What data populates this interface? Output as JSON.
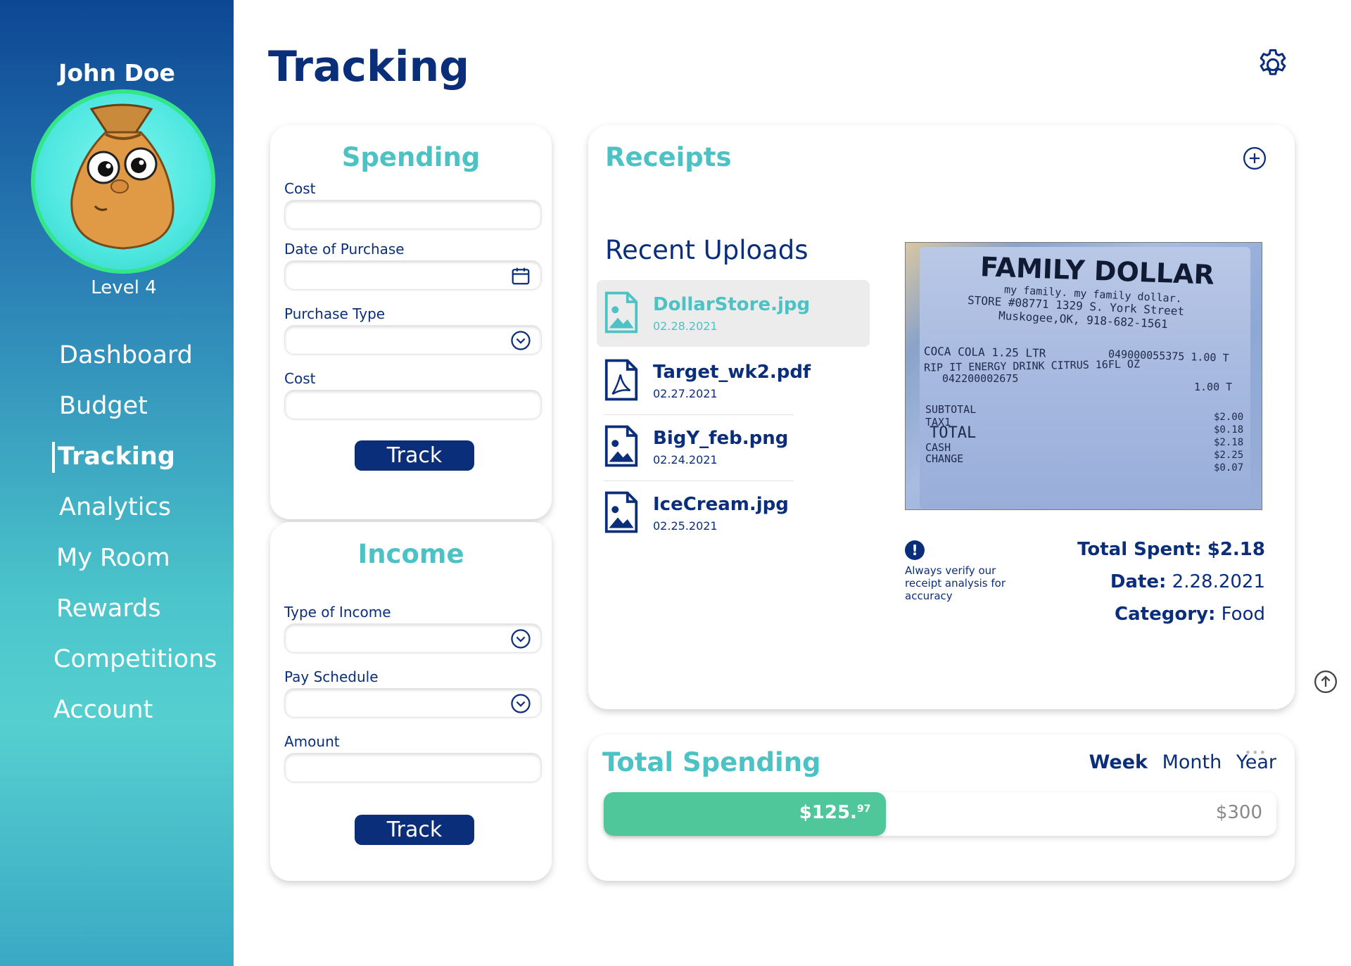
{
  "user": {
    "name": "John Doe",
    "level": "Level 4"
  },
  "nav": [
    {
      "label": "Dashboard",
      "active": false
    },
    {
      "label": "Budget",
      "active": false
    },
    {
      "label": "Tracking",
      "active": true
    },
    {
      "label": "Analytics",
      "active": false
    },
    {
      "label": "My Room",
      "active": false
    },
    {
      "label": "Rewards",
      "active": false
    },
    {
      "label": "Competitions",
      "active": false
    },
    {
      "label": "Account",
      "active": false
    }
  ],
  "page": {
    "title": "Tracking",
    "settings_icon": "gear-icon"
  },
  "spending": {
    "title": "Spending",
    "fields": [
      {
        "label": "Cost",
        "value": ""
      },
      {
        "label": "Date of Purchase",
        "value": "",
        "icon": "calendar-icon"
      },
      {
        "label": "Purchase Type",
        "value": "",
        "icon": "chevron-down-icon"
      },
      {
        "label": "Cost",
        "value": ""
      }
    ],
    "button": "Track"
  },
  "income": {
    "title": "Income",
    "fields": [
      {
        "label": "Type of Income",
        "value": "",
        "icon": "chevron-down-icon"
      },
      {
        "label": "Pay Schedule",
        "value": "",
        "icon": "chevron-down-icon"
      },
      {
        "label": "Amount",
        "value": ""
      }
    ],
    "button": "Track"
  },
  "receipts": {
    "title": "Receipts",
    "recent_title": "Recent Uploads",
    "files": [
      {
        "name": "DollarStore.jpg",
        "date": "02.28.2021",
        "type": "image",
        "selected": true
      },
      {
        "name": "Target_wk2.pdf",
        "date": "02.27.2021",
        "type": "pdf",
        "selected": false
      },
      {
        "name": "BigY_feb.png",
        "date": "02.24.2021",
        "type": "image",
        "selected": false
      },
      {
        "name": "IceCream.jpg",
        "date": "02.25.2021",
        "type": "image",
        "selected": false
      }
    ],
    "receipt_lines": {
      "store": "FAMILY DOLLAR",
      "tagline": "my family. my family dollar.",
      "address": "STORE #08771 1329 S. York Street",
      "city": "Muskogee,OK, 918-682-1561",
      "item1": "COCA COLA 1.25 LTR",
      "item1_code": "049000055375 1.00 T",
      "item2": "RIP IT ENERGY DRINK CITRUS 16FL OZ",
      "item2_code": "042200002675",
      "item2_price": "1.00 T",
      "subtotal": "SUBTOTAL",
      "tax": "TAX1",
      "total": "TOTAL",
      "cash": "CASH",
      "change": "CHANGE",
      "amounts": [
        "$2.00",
        "$0.18",
        "$2.18",
        "$2.25",
        "$0.07"
      ]
    },
    "warning": "Always verify our receipt analysis for accuracy",
    "total_spent_label": "Total Spent:",
    "total_spent_value": "$2.18",
    "date_label": "Date:",
    "date_value": "2.28.2021",
    "category_label": "Category:",
    "category_value": "Food"
  },
  "total_spending": {
    "title": "Total Spending",
    "periods": [
      "Week",
      "Month",
      "Year"
    ],
    "active_period": "Week",
    "amount_main": "$125.",
    "amount_cents": "97",
    "max": "$300",
    "progress_fraction": 0.4199
  },
  "colors": {
    "navy": "#0b2e7a",
    "teal": "#4cc2c4",
    "green": "#4fc79b"
  }
}
